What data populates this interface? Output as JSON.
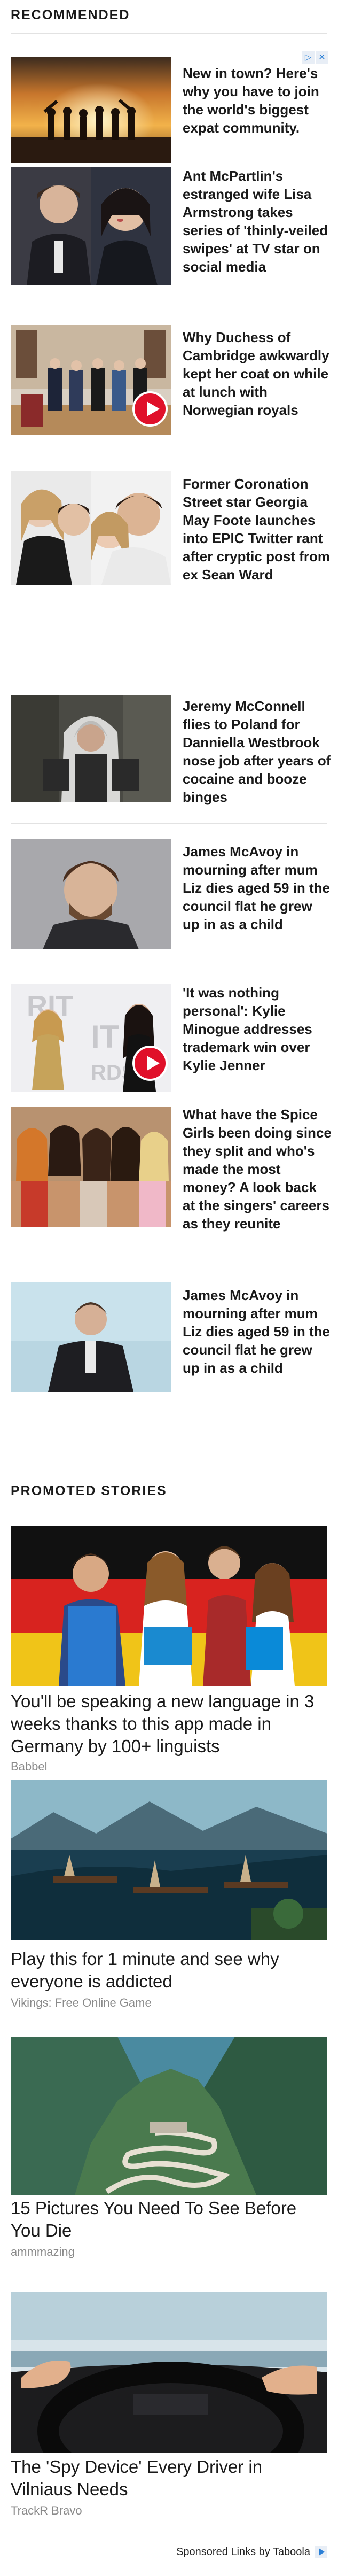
{
  "recommended": {
    "heading": "RECOMMENDED",
    "items": [
      {
        "headline": "New in town? Here's why you have to join the world's biggest expat community.",
        "thumb": "silhouette-friends-sunset",
        "video": false
      },
      {
        "headline": "Ant McPartlin's estranged wife Lisa Armstrong takes series of 'thinly-veiled swipes' at TV star on social media",
        "thumb": "couple-photo",
        "video": false
      },
      {
        "headline": "Why Duchess of Cambridge awkwardly kept her coat on while at lunch with Norwegian royals",
        "thumb": "royals-group",
        "video": true
      },
      {
        "headline": "Former Coronation Street star Georgia May Foote launches into EPIC Twitter rant after cryptic post from ex Sean Ward",
        "thumb": "couple-collage",
        "video": false
      },
      {
        "headline": "Jeremy McConnell flies to Poland for Danniella Westbrook nose job after years of cocaine and booze binges",
        "thumb": "man-hoodie",
        "video": false
      },
      {
        "headline": "James McAvoy in mourning after mum Liz dies aged 59 in the council flat he grew up in as a child",
        "thumb": "actor-portrait",
        "video": false
      },
      {
        "headline": "'It was nothing personal': Kylie Minogue addresses trademark win over Kylie Jenner",
        "thumb": "brit-awards",
        "video": true
      },
      {
        "headline": "What have the Spice Girls been doing since they split and who's made the most money? A look back at the singers' careers as they reunite",
        "thumb": "spice-girls",
        "video": false
      },
      {
        "headline": "James McAvoy in mourning after mum Liz dies aged 59 in the council flat he grew up in as a child",
        "thumb": "actor-jacket",
        "video": false
      }
    ],
    "adchoices": [
      "▷",
      "✕"
    ]
  },
  "promoted": {
    "heading": "PROMOTED STORIES",
    "items": [
      {
        "title": "You'll be speaking a new language in 3 weeks thanks to this app made in Germany by 100+ linguists",
        "source": "Babbel",
        "image": "students-flag"
      },
      {
        "title": "Play this for 1 minute and see why everyone is addicted",
        "source": "Vikings: Free Online Game",
        "image": "harbor-game"
      },
      {
        "title": "15 Pictures You Need To See Before You Die",
        "source": "ammmazing",
        "image": "mountain-road"
      },
      {
        "title": "The 'Spy Device' Every Driver in Vilniaus Needs",
        "source": "TrackR Bravo",
        "image": "driving-wheel"
      }
    ]
  },
  "footer": {
    "label": "Sponsored Links by Taboola"
  }
}
